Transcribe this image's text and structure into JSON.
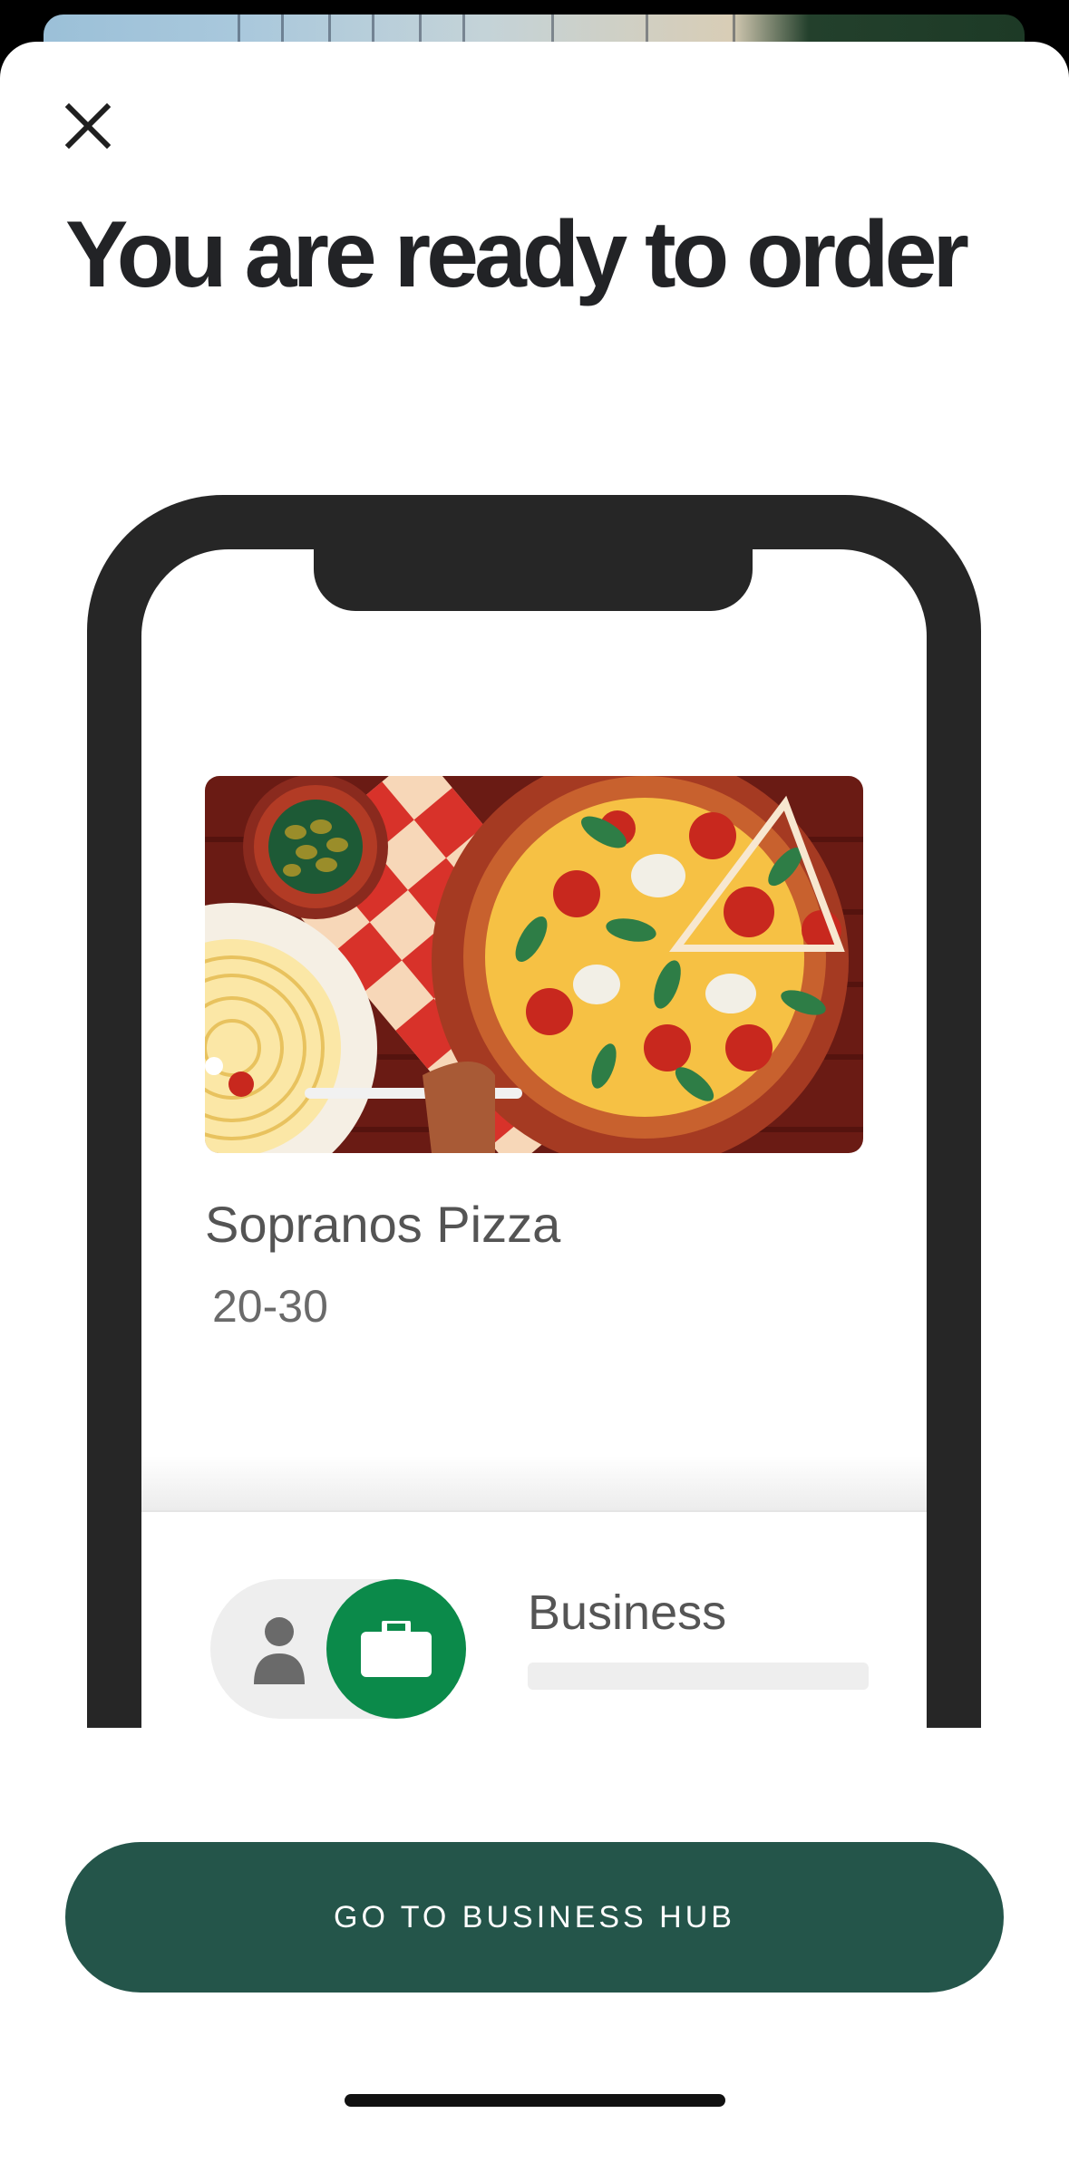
{
  "sheet": {
    "title": "You are ready to order",
    "close_icon": "close-icon"
  },
  "illustration": {
    "restaurant": {
      "name": "Sopranos Pizza",
      "eta": "20-30",
      "image_icon": "pizza-image"
    },
    "profile_toggle": {
      "options": [
        "personal",
        "business"
      ],
      "selected": "business",
      "label": "Business"
    }
  },
  "actions": {
    "primary_label": "GO TO BUSINESS HUB"
  },
  "colors": {
    "primary_button": "#24554a",
    "business_accent": "#0b8a4a",
    "title_text": "#222326"
  }
}
